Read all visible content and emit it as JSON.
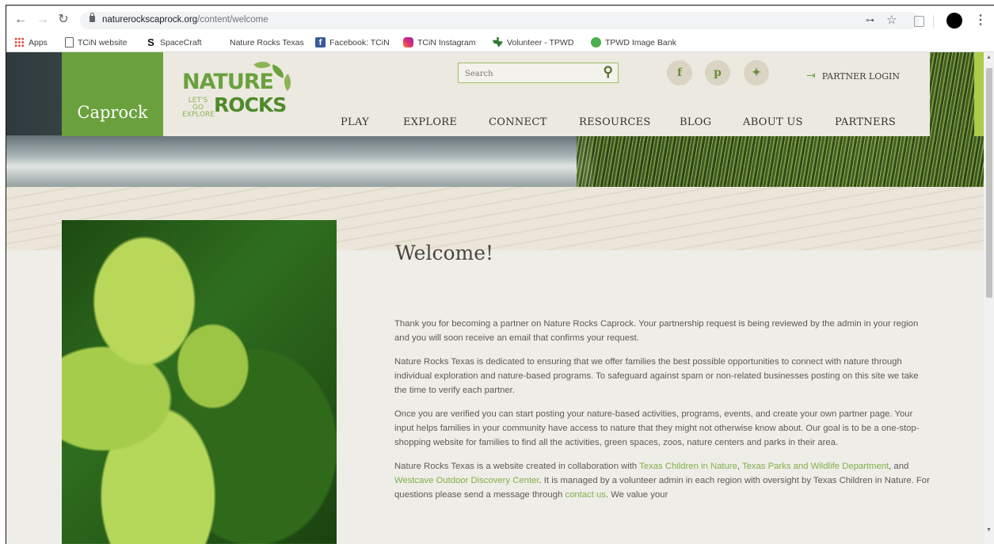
{
  "browser": {
    "url_host": "naturerockscaprock.org",
    "url_path": "/content/welcome"
  },
  "bookmarks": [
    {
      "label": "Apps",
      "icon": "apps-icon"
    },
    {
      "label": "TCiN website",
      "icon": "page-icon"
    },
    {
      "label": "SpaceCraft",
      "icon": "spacecraft-icon"
    },
    {
      "label": "Nature Rocks Texas",
      "icon": ""
    },
    {
      "label": "Facebook: TCiN",
      "icon": "facebook-icon"
    },
    {
      "label": "TCiN Instagram",
      "icon": "instagram-icon"
    },
    {
      "label": "Volunteer - TPWD",
      "icon": "texas-icon"
    },
    {
      "label": "TPWD Image Bank",
      "icon": "tpwd-icon"
    }
  ],
  "site": {
    "region_label": "Caprock",
    "logo": {
      "line1": "NATURE",
      "line2a": "LET'S GO",
      "line2b": "EXPLORE",
      "line3": "ROCKS"
    },
    "search_placeholder": "Search",
    "social": {
      "facebook": "f",
      "pinterest": "p",
      "twitter": "✦"
    },
    "partner_login": "PARTNER LOGIN",
    "nav": [
      "PLAY",
      "EXPLORE",
      "CONNECT",
      "RESOURCES",
      "BLOG",
      "ABOUT US",
      "PARTNERS"
    ]
  },
  "content": {
    "heading": "Welcome!",
    "p1": "Thank you for becoming a partner on Nature Rocks Caprock. Your partnership request is being reviewed by the admin in your region and you will soon receive an email that confirms your request.",
    "p2": "Nature Rocks Texas is dedicated to ensuring that we offer families the best possible opportunities to connect with nature through individual exploration and nature-based programs. To safeguard against spam or non-related businesses posting on this site we take the time to verify each partner.",
    "p3": "Once you are verified you can start posting your nature-based activities, programs, events, and create your own partner page. Your input helps families in your community have access to nature that they might not otherwise know about. Our goal is to be a one-stop-shopping website for families to find all the activities, green spaces, zoos, nature centers and parks in their area.",
    "p4_a": "Nature Rocks Texas is a website created in collaboration with ",
    "p4_link1": "Texas Children in Nature",
    "p4_b": ", ",
    "p4_link2": "Texas Parks and Wildlife Department",
    "p4_c": ", and ",
    "p4_link3": "Westcave Outdoor Discovery Center",
    "p4_d": ". It is managed by a volunteer admin in each region with oversight by Texas Children in Nature.  For questions please send a message through ",
    "p4_link4": "contact us",
    "p4_e": ".  We value your"
  }
}
